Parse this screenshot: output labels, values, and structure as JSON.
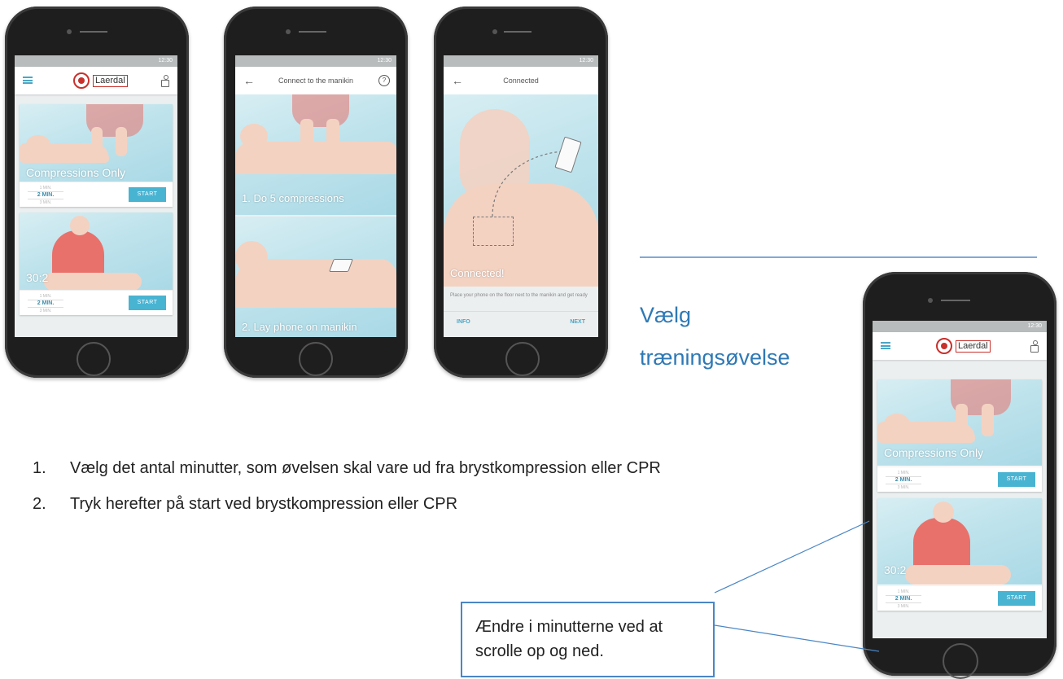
{
  "status_time": "12:30",
  "brand": "Laerdal",
  "screen_home": {
    "card1_title": "Compressions Only",
    "card2_title": "30:2",
    "minutes_above": "1 MIN.",
    "minutes_value": "2 MIN.",
    "minutes_below": "3 MIN.",
    "start_label": "START"
  },
  "screen_connect": {
    "title": "Connect to the manikin",
    "step1": "1. Do 5 compressions",
    "step2": "2. Lay phone on manikin"
  },
  "screen_connected": {
    "title": "Connected",
    "status": "Connected!",
    "instruction": "Place your phone on the floor next to the manikin and get ready",
    "info_button": "INFO",
    "next_button": "NEXT"
  },
  "heading_line1": "Vælg",
  "heading_line2": "træningsøvelse",
  "steps": [
    {
      "num": "1.",
      "text": "Vælg det antal minutter, som øvelsen skal vare ud fra brystkompression eller CPR"
    },
    {
      "num": "2.",
      "text": "Tryk herefter på start ved brystkompression eller CPR"
    }
  ],
  "callout": "Ændre i minutterne ved at scrolle op og ned."
}
